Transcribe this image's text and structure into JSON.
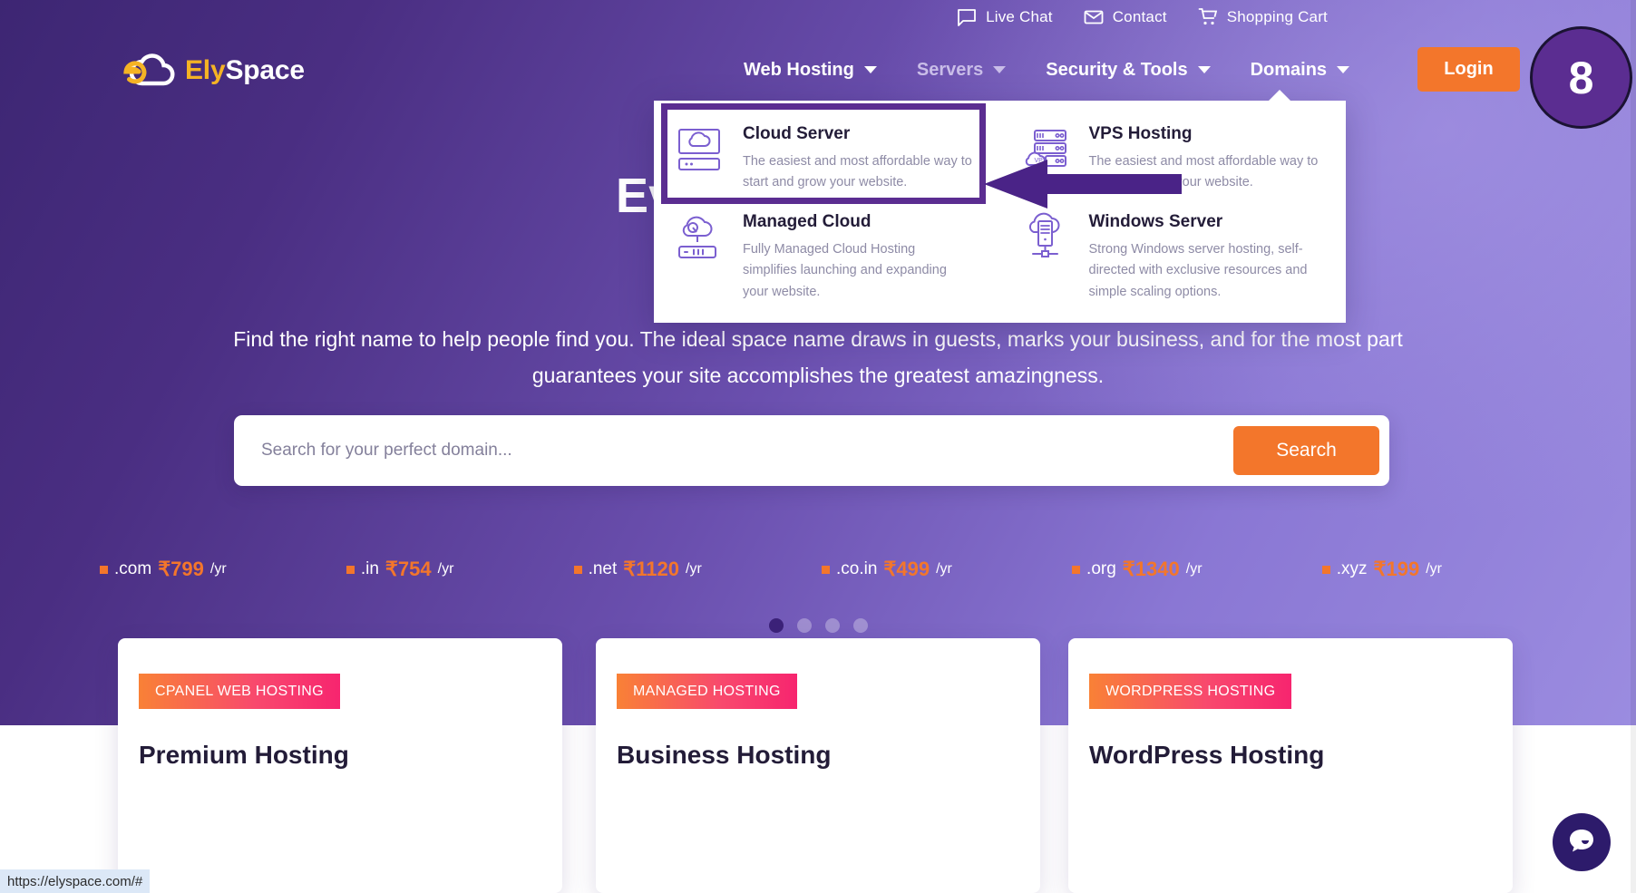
{
  "brand": {
    "name_part1": "Ely",
    "name_part2": "Space",
    "logo_icon": "cloud-e-logo-icon",
    "accent_orange": "#f3762b",
    "accent_yellow": "#f5b324",
    "primary_purple": "#5b2d91"
  },
  "utility_bar": {
    "items": [
      {
        "label": "Live Chat",
        "icon": "chat-bubble-icon"
      },
      {
        "label": "Contact",
        "icon": "envelope-icon"
      },
      {
        "label": "Shopping Cart",
        "icon": "shopping-cart-icon"
      }
    ]
  },
  "nav": {
    "items": [
      {
        "label": "Web Hosting",
        "has_caret": true,
        "active": false
      },
      {
        "label": "Servers",
        "has_caret": true,
        "active": true
      },
      {
        "label": "Security & Tools",
        "has_caret": true,
        "active": false
      },
      {
        "label": "Domains",
        "has_caret": true,
        "active": false
      }
    ],
    "login_label": "Login",
    "step_badge": "8"
  },
  "dropdown": {
    "open_for": "Servers",
    "left_column": [
      {
        "icon": "cloud-server-icon",
        "title": "Cloud Server",
        "desc": "The easiest and most affordable way to start and grow your website.",
        "highlighted": true
      },
      {
        "icon": "managed-cloud-icon",
        "title": "Managed Cloud",
        "desc": "Fully Managed Cloud Hosting simplifies launching and expanding your website."
      }
    ],
    "right_column": [
      {
        "icon": "vps-hosting-icon",
        "title": "VPS Hosting",
        "desc": "The easiest and most affordable way to start and grow your website."
      },
      {
        "icon": "windows-server-icon",
        "title": "Windows Server",
        "desc": "Strong Windows server hosting, self-directed with exclusive resources and simple scaling options."
      }
    ]
  },
  "hero": {
    "title": "Every successful",
    "subtitle": "Find the right name to help people find you. The ideal space name draws in guests, marks your business, and for the most part guarantees your site accomplishes the greatest amazingness."
  },
  "search": {
    "placeholder": "Search for your perfect domain...",
    "value": "",
    "button_label": "Search"
  },
  "tlds": [
    {
      "name": ".com",
      "price": "₹799",
      "per": "/yr"
    },
    {
      "name": ".in",
      "price": "₹754",
      "per": "/yr"
    },
    {
      "name": ".net",
      "price": "₹1120",
      "per": "/yr"
    },
    {
      "name": ".co.in",
      "price": "₹499",
      "per": "/yr"
    },
    {
      "name": ".org",
      "price": "₹1340",
      "per": "/yr"
    },
    {
      "name": ".xyz",
      "price": "₹199",
      "per": "/yr"
    }
  ],
  "carousel": {
    "total": 4,
    "active_index": 0
  },
  "cards": [
    {
      "badge": "CPANEL WEB HOSTING",
      "title": "Premium Hosting"
    },
    {
      "badge": "MANAGED HOSTING",
      "title": "Business Hosting"
    },
    {
      "badge": "WORDPRESS HOSTING",
      "title": "WordPress Hosting"
    }
  ],
  "status_bar": {
    "url": "https://elyspace.com/#"
  },
  "chat_widget": {
    "icon": "chat-bubble-filled-icon"
  }
}
